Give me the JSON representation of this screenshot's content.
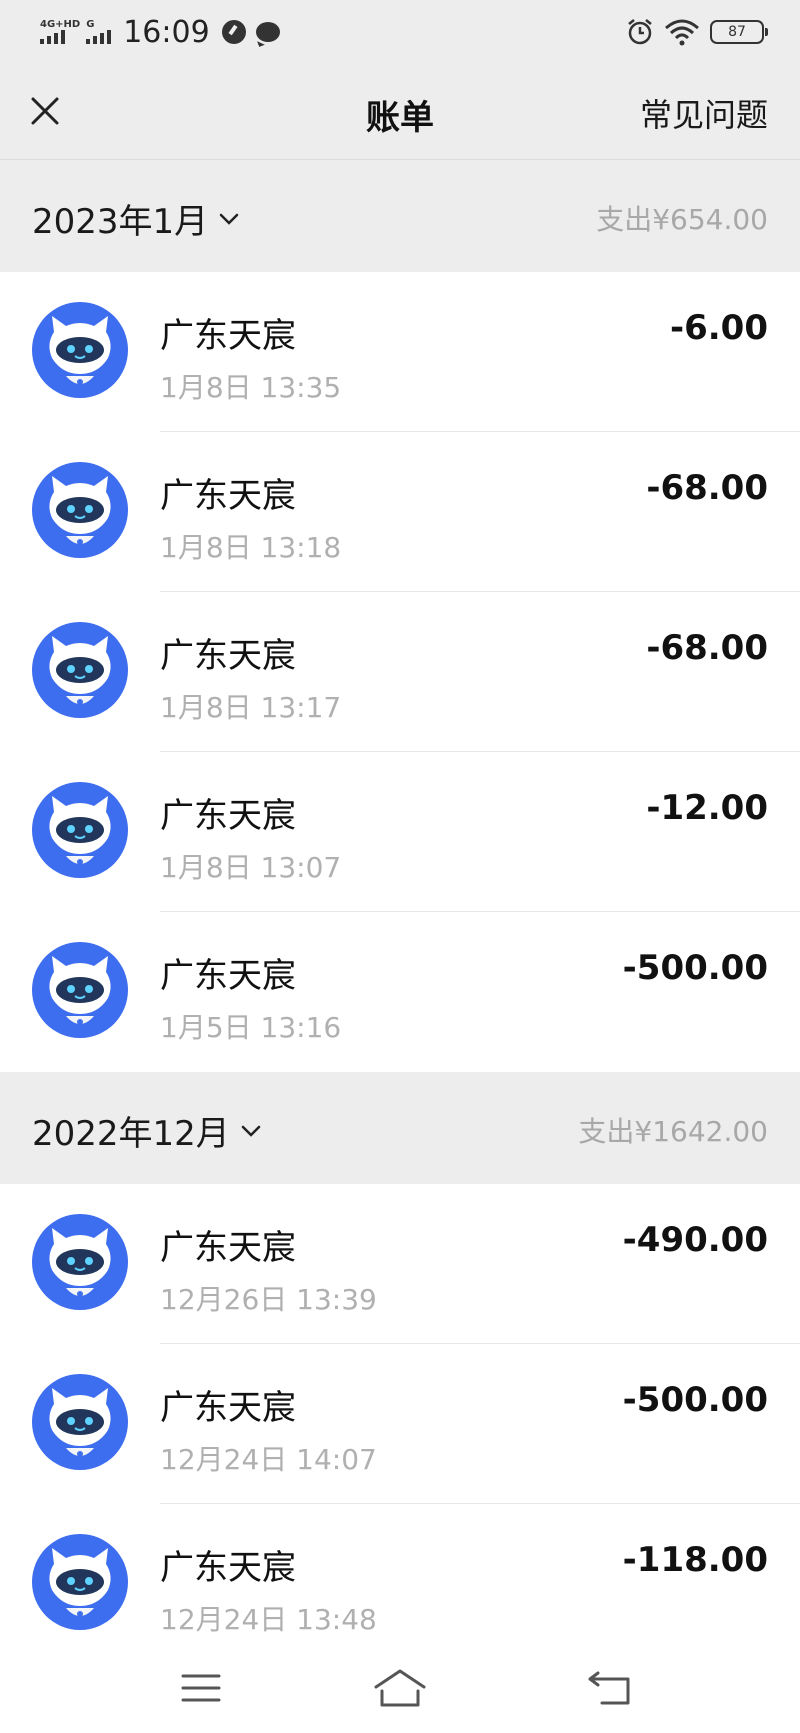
{
  "status_bar": {
    "network_1": "4G+HD",
    "network_2": "G",
    "time": "16:09",
    "battery": "87"
  },
  "header": {
    "title": "账单",
    "faq_label": "常见问题"
  },
  "sections": [
    {
      "month": "2023年1月",
      "total": "支出¥654.00",
      "items": [
        {
          "merchant": "广东天宸",
          "datetime": "1月8日 13:35",
          "amount": "-6.00"
        },
        {
          "merchant": "广东天宸",
          "datetime": "1月8日 13:18",
          "amount": "-68.00"
        },
        {
          "merchant": "广东天宸",
          "datetime": "1月8日 13:17",
          "amount": "-68.00"
        },
        {
          "merchant": "广东天宸",
          "datetime": "1月8日 13:07",
          "amount": "-12.00"
        },
        {
          "merchant": "广东天宸",
          "datetime": "1月5日 13:16",
          "amount": "-500.00"
        }
      ]
    },
    {
      "month": "2022年12月",
      "total": "支出¥1642.00",
      "items": [
        {
          "merchant": "广东天宸",
          "datetime": "12月26日 13:39",
          "amount": "-490.00"
        },
        {
          "merchant": "广东天宸",
          "datetime": "12月24日 14:07",
          "amount": "-500.00"
        },
        {
          "merchant": "广东天宸",
          "datetime": "12月24日 13:48",
          "amount": "-118.00"
        }
      ]
    }
  ],
  "colors": {
    "avatar_blue": "#3d6ef0",
    "header_bg": "#ededed",
    "muted_text": "#b0b0b0"
  }
}
